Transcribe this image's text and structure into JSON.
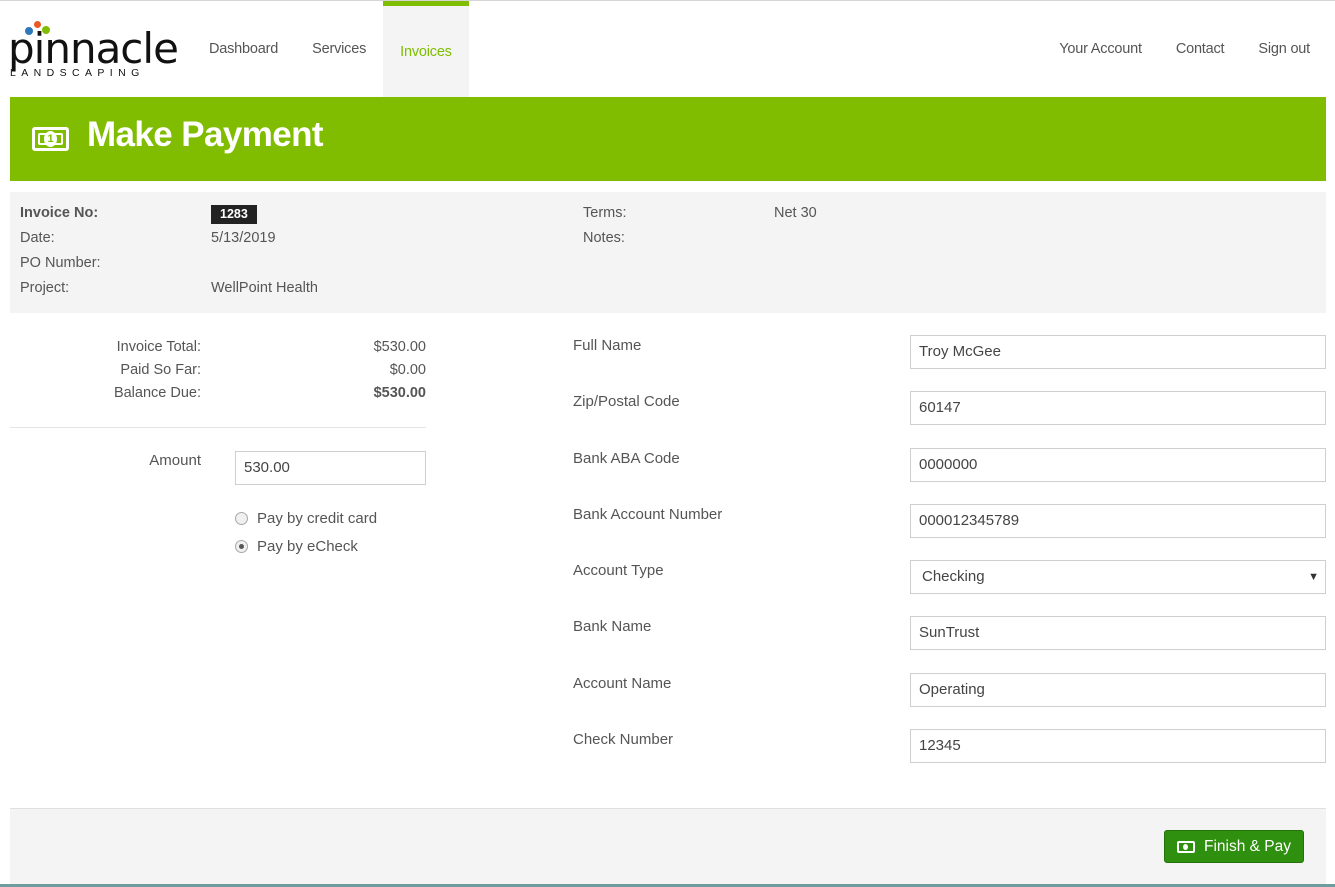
{
  "brand": {
    "name": "pinnacle",
    "tagline": "LANDSCAPING"
  },
  "nav": {
    "left": [
      {
        "label": "Dashboard",
        "active": false
      },
      {
        "label": "Services",
        "active": false
      },
      {
        "label": "Invoices",
        "active": true
      }
    ],
    "right": [
      {
        "label": "Your Account"
      },
      {
        "label": "Contact"
      },
      {
        "label": "Sign out"
      }
    ]
  },
  "header": {
    "title": "Make Payment",
    "icon": "money-bill-icon"
  },
  "invoice": {
    "invoice_no_label": "Invoice No:",
    "invoice_no": "1283",
    "date_label": "Date:",
    "date": "5/13/2019",
    "po_label": "PO Number:",
    "po": "",
    "project_label": "Project:",
    "project": "WellPoint Health",
    "terms_label": "Terms:",
    "terms": "Net 30",
    "notes_label": "Notes:",
    "notes": ""
  },
  "totals": {
    "invoice_total_label": "Invoice Total:",
    "invoice_total": "$530.00",
    "paid_label": "Paid So Far:",
    "paid": "$0.00",
    "balance_label": "Balance Due:",
    "balance": "$530.00"
  },
  "payment": {
    "amount_label": "Amount",
    "amount": "530.00",
    "methods": [
      {
        "label": "Pay by credit card",
        "selected": false
      },
      {
        "label": "Pay by eCheck",
        "selected": true
      }
    ]
  },
  "form": {
    "full_name": {
      "label": "Full Name",
      "value": "Troy McGee"
    },
    "zip": {
      "label": "Zip/Postal Code",
      "value": "60147"
    },
    "aba": {
      "label": "Bank ABA Code",
      "value": "0000000"
    },
    "account_number": {
      "label": "Bank Account Number",
      "value": "000012345789"
    },
    "account_type": {
      "label": "Account Type",
      "value": "Checking"
    },
    "bank_name": {
      "label": "Bank Name",
      "value": "SunTrust"
    },
    "account_name": {
      "label": "Account Name",
      "value": "Operating"
    },
    "check_number": {
      "label": "Check Number",
      "value": "12345"
    }
  },
  "actions": {
    "finish_label": "Finish & Pay"
  },
  "colors": {
    "accent": "#80bd00",
    "button": "#2f8f0e",
    "panel": "#f4f4f4"
  }
}
